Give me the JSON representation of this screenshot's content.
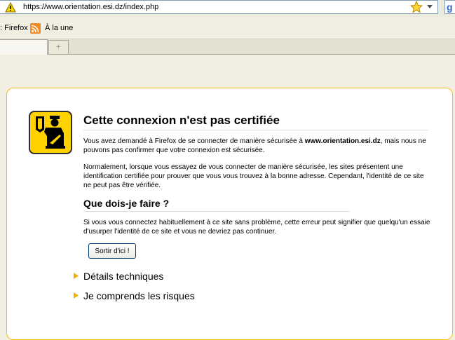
{
  "urlbar": {
    "url": "https://www.orientation.esi.dz/index.php",
    "google_glyph": "g"
  },
  "icons": {
    "security_warning": "warning-triangle-icon",
    "bookmark_star": "star-icon",
    "dropdown": "chevron-down-icon",
    "rss": "rss-feed-icon",
    "new_tab": "plus-icon",
    "certificate": "border-guard-icon",
    "expander": "triangle-right-icon"
  },
  "bookmarks": {
    "items": [
      {
        "label": ": Firefox"
      },
      {
        "label": "À la une"
      }
    ]
  },
  "tabs": {
    "new_tab_glyph": "+"
  },
  "error_page": {
    "title": "Cette connexion n'est pas certifiée",
    "para1_pre": "Vous avez demandé à Firefox de se connecter de manière sécurisée à ",
    "para1_host": "www.orientation.esi.dz",
    "para1_post": ", mais nous ne pouvons pas confirmer que votre connexion est sécurisée.",
    "para2": "Normalement, lorsque vous essayez de vous connecter de manière sécurisée, les sites présentent une identification certifiée pour prouver que vous vous trouvez à la bonne adresse. Cependant, l'identité de ce site ne peut pas être vérifiée.",
    "what_to_do_heading": "Que dois-je faire ?",
    "para3": "Si vous vous connectez habituellement à ce site sans problème, cette erreur peut signifier que quelqu'un essaie d'usurper l'identité de ce site et vous ne devriez pas continuer.",
    "get_me_out_button": "Sortir d'ici !",
    "technical_details": "Détails techniques",
    "understand_risks": "Je comprends les risques"
  },
  "colors": {
    "accent_border": "#ffbd09",
    "expander_arrow": "#f0b000",
    "page_background": "#f1efe2"
  }
}
